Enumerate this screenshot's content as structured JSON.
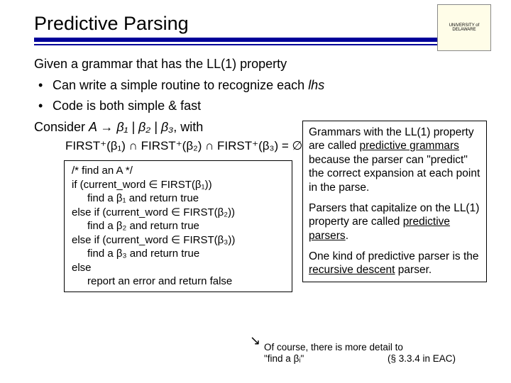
{
  "title": "Predictive Parsing",
  "logo_text": "UNIVERSITY of DELAWARE",
  "intro": "Given a grammar that has the LL(1) property",
  "bullets": [
    "Can write a simple routine to recognize each lhs",
    "Code is both simple & fast"
  ],
  "consider_prefix": "Consider ",
  "consider_formula": "A → β₁ | β₂ | β₃",
  "consider_suffix": ", with",
  "first_line": "FIRST⁺(β₁) ∩ FIRST⁺(β₂) ∩ FIRST⁺(β₃) = ∅",
  "code": {
    "c0": "/* find an A */",
    "c1": "if (current_word ∈ FIRST(β₁))",
    "c2": "find a β₁ and return true",
    "c3": "else if (current_word ∈ FIRST(β₂))",
    "c4": "find a β₂ and return true",
    "c5": "else if (current_word ∈ FIRST(β₃))",
    "c6": "find a β₃ and return true",
    "c7": "else",
    "c8": "report an error and return false"
  },
  "side": {
    "p1a": "Grammars with the LL(1) property are called ",
    "p1u": "predictive grammars",
    "p1b": " because the parser can \"predict\" the correct expansion at each point in the parse.",
    "p2a": "Parsers that capitalize on the LL(1) property are called ",
    "p2u": "predictive parsers",
    "p2b": ".",
    "p3a": "One kind of predictive parser is the ",
    "p3u": "recursive descent",
    "p3b": " parser."
  },
  "note_l1": "Of course, there is more detail to",
  "note_l2a": "\"find a βᵢ\"",
  "note_l2b": "(§ 3.3.4 in EAC)"
}
